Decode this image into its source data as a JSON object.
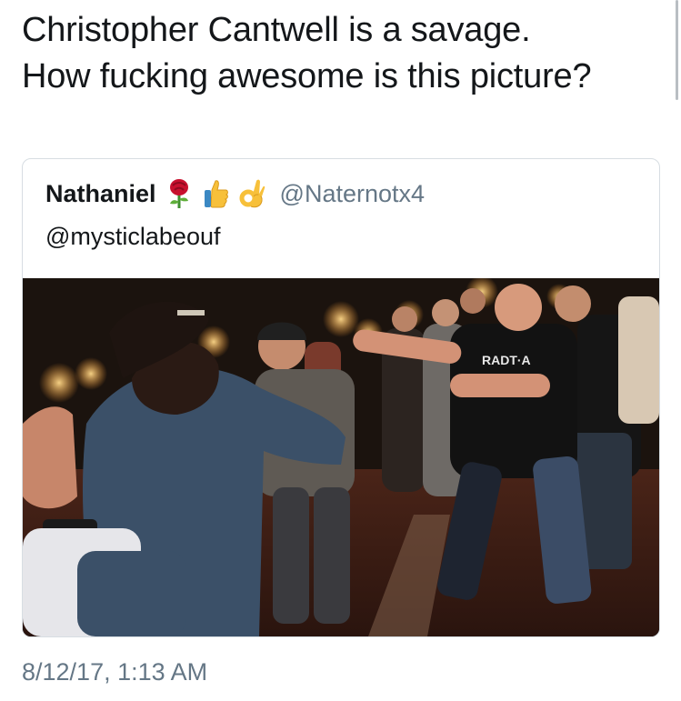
{
  "tweet": {
    "text_line1": "Christopher Cantwell is a savage.",
    "text_line2": "How fucking awesome is this picture?",
    "timestamp": "8/12/17, 1:13 AM"
  },
  "quoted_tweet": {
    "author_name": "Nathaniel",
    "author_emojis": [
      "rose-icon",
      "thumbs-up-icon",
      "ok-hand-icon"
    ],
    "author_handle": "@Naternotx4",
    "replying_to": "@mysticlabeouf",
    "photo_shirt_text": "RADT·A"
  },
  "colors": {
    "text": "#14171a",
    "secondary_text": "#657786",
    "card_border": "#d7dde2"
  }
}
